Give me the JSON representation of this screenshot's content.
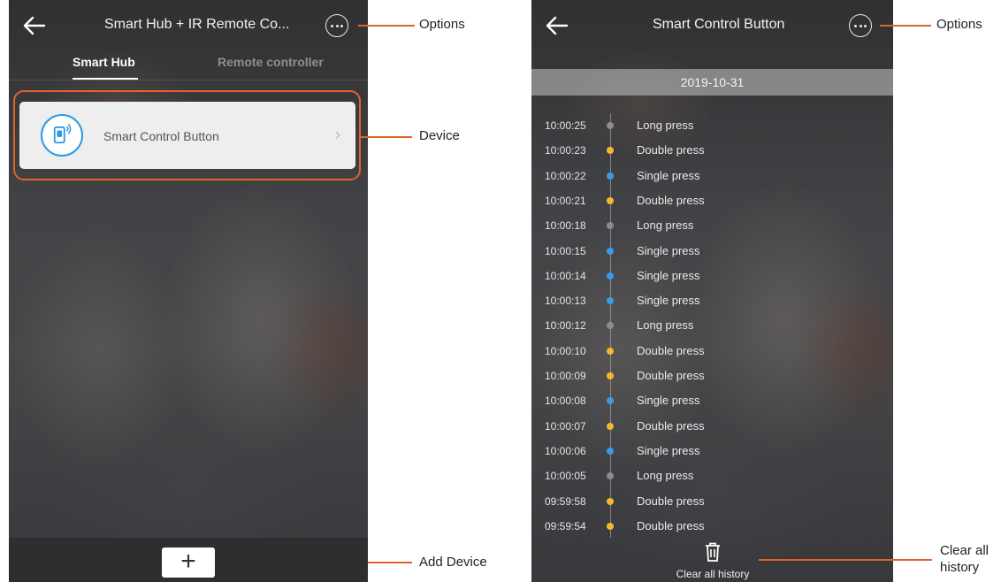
{
  "left_screen": {
    "title": "Smart Hub + IR Remote Co...",
    "tabs": [
      {
        "label": "Smart Hub",
        "active": true
      },
      {
        "label": "Remote controller",
        "active": false
      }
    ],
    "device": {
      "label": "Smart Control Button",
      "icon": "remote-button-icon"
    },
    "add_button_glyph": "+"
  },
  "right_screen": {
    "title": "Smart Control Button",
    "date": "2019-10-31",
    "log": [
      {
        "time": "10:00:25",
        "event": "Long press"
      },
      {
        "time": "10:00:23",
        "event": "Double press"
      },
      {
        "time": "10:00:22",
        "event": "Single press"
      },
      {
        "time": "10:00:21",
        "event": "Double press"
      },
      {
        "time": "10:00:18",
        "event": "Long press"
      },
      {
        "time": "10:00:15",
        "event": "Single press"
      },
      {
        "time": "10:00:14",
        "event": "Single press"
      },
      {
        "time": "10:00:13",
        "event": "Single press"
      },
      {
        "time": "10:00:12",
        "event": "Long press"
      },
      {
        "time": "10:00:10",
        "event": "Double press"
      },
      {
        "time": "10:00:09",
        "event": "Double press"
      },
      {
        "time": "10:00:08",
        "event": "Single press"
      },
      {
        "time": "10:00:07",
        "event": "Double press"
      },
      {
        "time": "10:00:06",
        "event": "Single press"
      },
      {
        "time": "10:00:05",
        "event": "Long press"
      },
      {
        "time": "09:59:58",
        "event": "Double press"
      },
      {
        "time": "09:59:54",
        "event": "Double press"
      }
    ],
    "clear_label": "Clear all history"
  },
  "callouts": {
    "options_left": "Options",
    "device": "Device",
    "add_device": "Add Device",
    "options_right": "Options",
    "clear_line1": "Clear all",
    "clear_line2": "history"
  },
  "colors": {
    "accent": "#e0632a",
    "long_press": "#8c8c8c",
    "double_press": "#f5b82e",
    "single_press": "#3a9ce8",
    "device_icon": "#2b9ae4"
  }
}
